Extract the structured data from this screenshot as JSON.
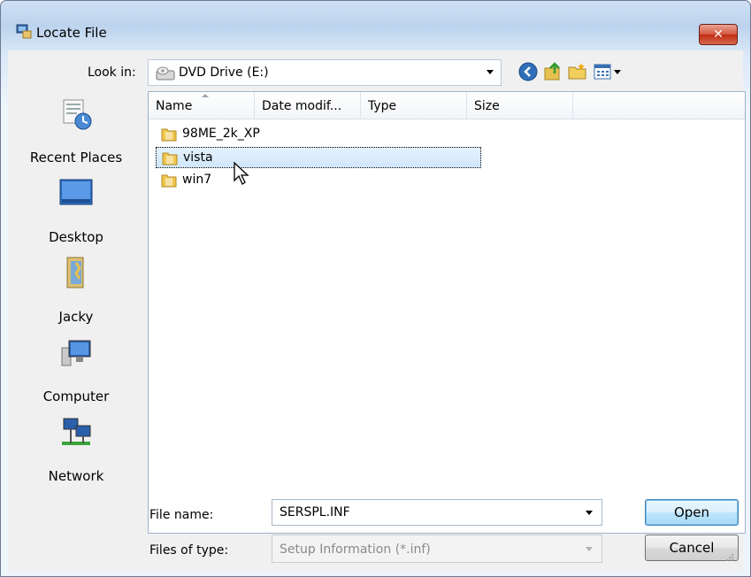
{
  "window": {
    "title": "Locate File"
  },
  "lookin": {
    "label": "Look in:",
    "value": "DVD Drive (E:)"
  },
  "toolbar": {
    "icons": [
      "back-icon",
      "up-folder-icon",
      "new-folder-icon",
      "views-menu-icon"
    ]
  },
  "places": [
    {
      "label": "Recent Places",
      "icon": "recent-places-icon"
    },
    {
      "label": "Desktop",
      "icon": "desktop-icon"
    },
    {
      "label": "Jacky",
      "icon": "user-folder-icon"
    },
    {
      "label": "Computer",
      "icon": "computer-icon"
    },
    {
      "label": "Network",
      "icon": "network-icon"
    }
  ],
  "columns": [
    "Name",
    "Date modif...",
    "Type",
    "Size"
  ],
  "files": [
    {
      "name": "98ME_2k_XP",
      "selected": false
    },
    {
      "name": "vista",
      "selected": true
    },
    {
      "name": "win7",
      "selected": false
    }
  ],
  "filename": {
    "label": "File name:",
    "value": "SERSPL.INF"
  },
  "filetype": {
    "label": "Files of type:",
    "value": "Setup Information (*.inf)"
  },
  "buttons": {
    "open": "Open",
    "cancel": "Cancel"
  },
  "colors": {
    "accent": "#3c7fb1",
    "close": "#c02a12",
    "selection": "#cfe6fb"
  }
}
